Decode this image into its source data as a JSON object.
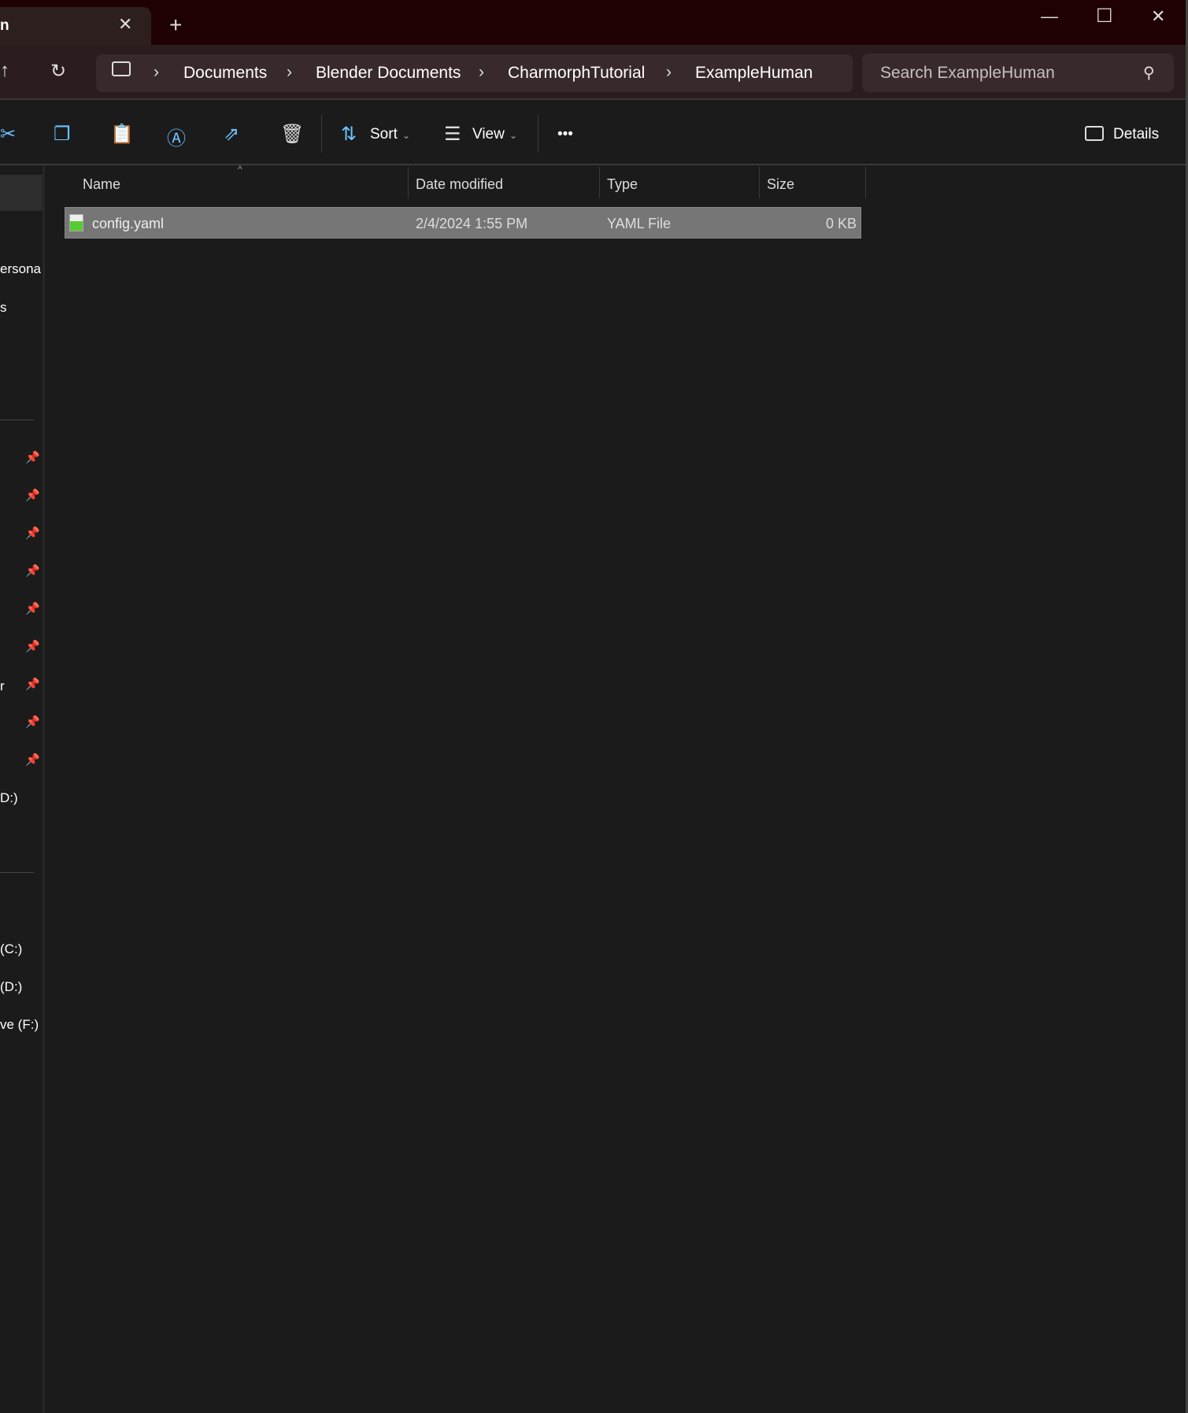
{
  "window": {
    "tab_title": "ExampleHuman",
    "tab_title_visible": "n"
  },
  "breadcrumb": [
    "Documents",
    "Blender Documents",
    "CharmorphTutorial",
    "ExampleHuman"
  ],
  "search": {
    "placeholder": "Search ExampleHuman"
  },
  "toolbar": {
    "sort_label": "Sort",
    "view_label": "View",
    "more_label": "•••",
    "details_label": "Details"
  },
  "sidebar": {
    "items": [
      "ersona",
      "s",
      "r",
      "D:)",
      "(C:)",
      "(D:)",
      "ve (F:)"
    ]
  },
  "columns": [
    "Name",
    "Date modified",
    "Type",
    "Size"
  ],
  "files": [
    {
      "name": "config.yaml",
      "date": "2/4/2024 1:55 PM",
      "type": "YAML File",
      "size": "0 KB",
      "selected": true
    }
  ],
  "colors": {
    "titlebar": "#1f0003",
    "accent": "#6cc3ff",
    "selection": "#767676"
  }
}
